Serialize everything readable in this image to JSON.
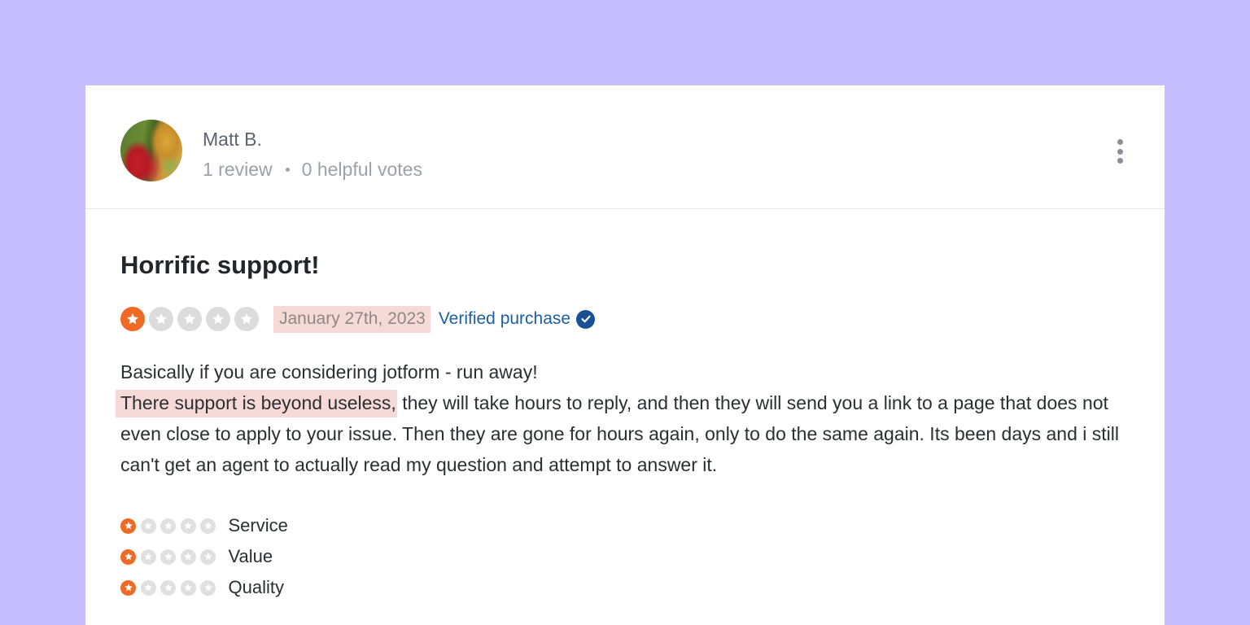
{
  "review": {
    "user": {
      "name": "Matt B.",
      "review_count": "1 review",
      "helpful_votes": "0 helpful votes",
      "avatar_icon": "avatar-photo"
    },
    "menu_icon": "kebab-menu-icon",
    "title": "Horrific support!",
    "rating": {
      "value": 1,
      "max": 5
    },
    "date": "January 27th, 2023",
    "verified_label": "Verified purchase",
    "verified_icon": "check-circle-icon",
    "body": {
      "line1": "Basically if you are considering jotform - run away!",
      "highlighted": "There support is beyond useless,",
      "rest": " they will take hours to reply, and then they will send you a link to a page that does not even close to apply to your issue. Then they are gone for hours again, only to do the same again. Its been days and i still can't get an agent to actually read my question and attempt to answer it."
    },
    "sub_ratings": [
      {
        "label": "Service",
        "value": 1,
        "max": 5
      },
      {
        "label": "Value",
        "value": 1,
        "max": 5
      },
      {
        "label": "Quality",
        "value": 1,
        "max": 5
      }
    ]
  },
  "colors": {
    "background": "#c6beff",
    "star_active": "#ef6a24",
    "star_inactive": "#dcdcdc",
    "highlight": "#f6dad7",
    "verified_link": "#1b5fa6"
  }
}
